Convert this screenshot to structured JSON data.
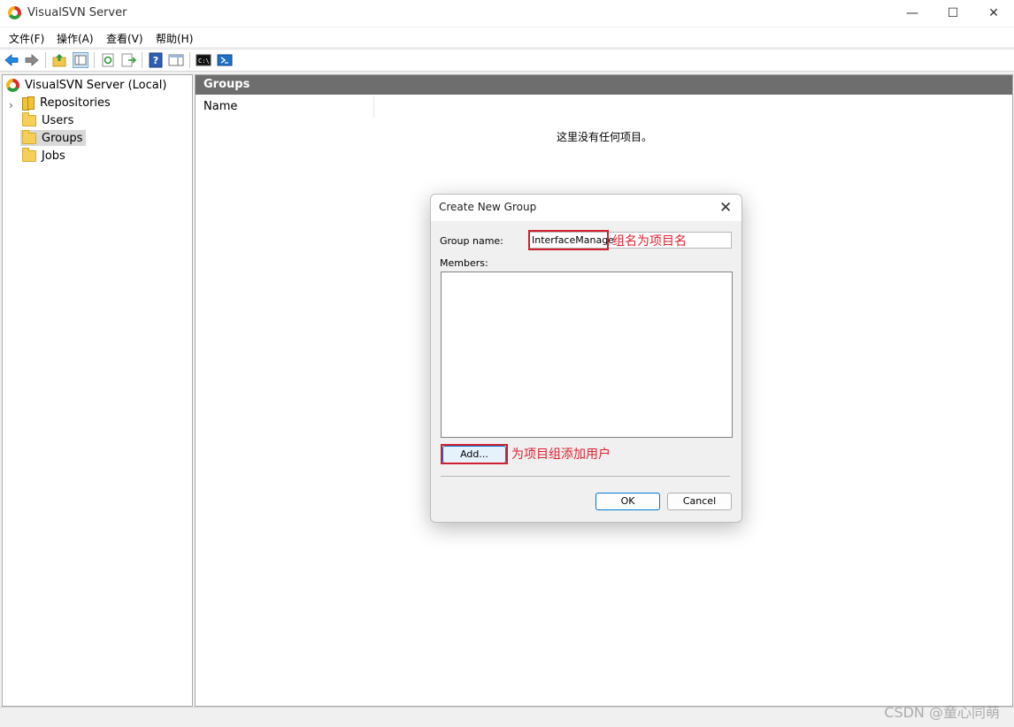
{
  "window": {
    "title": "VisualSVN Server",
    "controls": {
      "minimize": "—",
      "maximize": "☐",
      "close": "✕"
    }
  },
  "menu": [
    {
      "label": "文件(F)"
    },
    {
      "label": "操作(A)"
    },
    {
      "label": "查看(V)"
    },
    {
      "label": "帮助(H)"
    }
  ],
  "toolbar": {
    "icons": [
      "back-arrow-icon",
      "forward-arrow-icon",
      "up-folder-icon",
      "show-hide-tree-icon",
      "refresh-icon",
      "export-list-icon",
      "help-icon",
      "action-pane-icon",
      "console-icon",
      "powershell-icon"
    ]
  },
  "tree": {
    "root": "VisualSVN Server (Local)",
    "items": [
      {
        "label": "Repositories",
        "icon": "repositories-icon"
      },
      {
        "label": "Users",
        "icon": "folder-icon"
      },
      {
        "label": "Groups",
        "icon": "folder-icon",
        "selected": true
      },
      {
        "label": "Jobs",
        "icon": "folder-icon"
      }
    ]
  },
  "content": {
    "header": "Groups",
    "column_name": "Name",
    "empty_message": "这里没有任何项目。"
  },
  "dialog": {
    "title": "Create New Group",
    "group_name_label": "Group name:",
    "group_name_value": "InterfaceManage",
    "members_label": "Members:",
    "add_button": "Add...",
    "ok_button": "OK",
    "cancel_button": "Cancel",
    "annotation_name": "组名为项目名",
    "annotation_add": "为项目组添加用户",
    "annotation_color": "#d0202f"
  },
  "watermark": "CSDN @童心同萌"
}
